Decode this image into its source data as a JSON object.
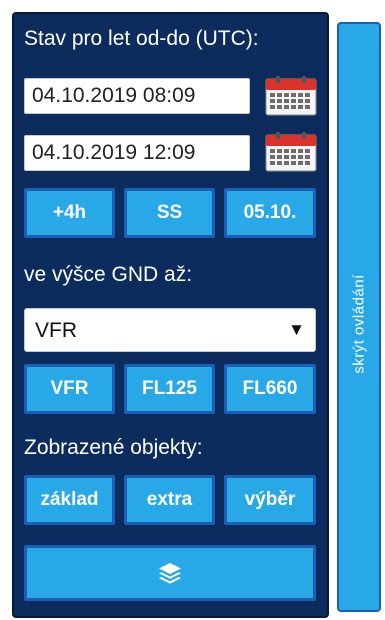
{
  "time_range": {
    "label": "Stav pro let od-do (UTC):",
    "from_value": "04.10.2019 08:09",
    "to_value": "04.10.2019 12:09",
    "calendar_icon": "calendar-icon"
  },
  "time_buttons": {
    "plus4h": "+4h",
    "ss": "SS",
    "date": "05.10."
  },
  "altitude": {
    "label": "ve výšce GND až:",
    "selected": "VFR",
    "buttons": {
      "vfr": "VFR",
      "fl125": "FL125",
      "fl660": "FL660"
    }
  },
  "objects": {
    "label": "Zobrazené objekty:",
    "buttons": {
      "zaklad": "základ",
      "extra": "extra",
      "vyber": "výběr"
    },
    "layers_icon": "layers-icon"
  },
  "side_tab": {
    "label": "skrýt ovládání"
  },
  "colors": {
    "panel_bg": "#0b2c5c",
    "button_bg": "#29a8e8",
    "button_border": "#1a5fb5",
    "calendar_red": "#d9332b"
  }
}
